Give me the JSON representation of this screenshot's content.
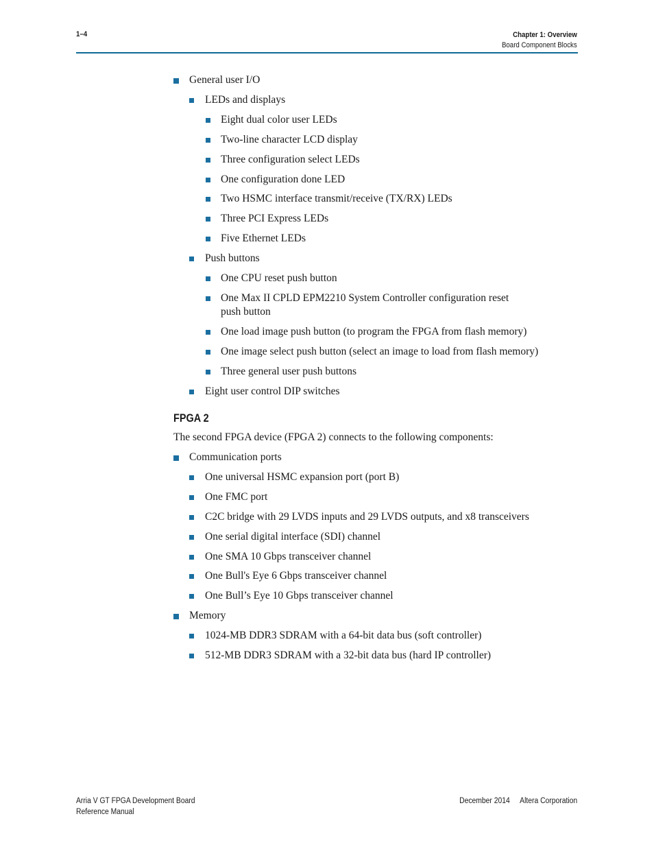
{
  "header": {
    "page_number": "1–4",
    "chapter": "Chapter 1:  Overview",
    "section": "Board Component Blocks"
  },
  "list_fpga1": [
    {
      "level": 1,
      "text": "General user I/O"
    },
    {
      "level": 2,
      "text": "LEDs and displays"
    },
    {
      "level": 3,
      "text": "Eight dual color user LEDs"
    },
    {
      "level": 3,
      "text": "Two-line character LCD display"
    },
    {
      "level": 3,
      "text": "Three configuration select LEDs"
    },
    {
      "level": 3,
      "text": "One configuration done LED"
    },
    {
      "level": 3,
      "text": "Two HSMC interface transmit/receive (TX/RX) LEDs"
    },
    {
      "level": 3,
      "text": "Three PCI Express LEDs"
    },
    {
      "level": 3,
      "text": "Five Ethernet LEDs"
    },
    {
      "level": 2,
      "text": "Push buttons"
    },
    {
      "level": 3,
      "text": "One CPU reset push button"
    },
    {
      "level": 3,
      "text": "One Max II CPLD EPM2210 System Controller configuration reset",
      "cont": "push button"
    },
    {
      "level": 3,
      "text": "One load image push button (to program the FPGA from flash memory)"
    },
    {
      "level": 3,
      "text": "One image select push button (select an image to load from flash memory)"
    },
    {
      "level": 3,
      "text": "Three general user push buttons"
    },
    {
      "level": 2,
      "text": "Eight user control DIP switches"
    }
  ],
  "fpga2": {
    "heading": "FPGA 2",
    "intro": "The second FPGA device (FPGA 2) connects to the following components:",
    "list": [
      {
        "level": 1,
        "text": "Communication ports"
      },
      {
        "level": 2,
        "text": "One universal HSMC expansion port (port B)"
      },
      {
        "level": 2,
        "text": "One FMC port"
      },
      {
        "level": 2,
        "text": "C2C bridge with 29 LVDS inputs and 29 LVDS outputs, and x8 transceivers"
      },
      {
        "level": 2,
        "text": "One serial digital interface (SDI) channel"
      },
      {
        "level": 2,
        "text": "One SMA 10 Gbps transceiver channel"
      },
      {
        "level": 2,
        "text": "One Bull's Eye 6 Gbps transceiver channel"
      },
      {
        "level": 2,
        "text": "One Bull’s Eye 10 Gbps transceiver channel"
      },
      {
        "level": 1,
        "text": "Memory"
      },
      {
        "level": 2,
        "text": "1024-MB DDR3 SDRAM with a 64-bit data bus (soft controller)"
      },
      {
        "level": 2,
        "text": "512-MB DDR3 SDRAM with a 32-bit data bus (hard IP controller)"
      }
    ]
  },
  "footer": {
    "title_line1": "Arria V GT FPGA Development Board",
    "title_line2": "Reference Manual",
    "date": "December 2014",
    "company": "Altera Corporation"
  },
  "colors": {
    "accent": "#0f6a96",
    "bullet": "#1b6fa0"
  }
}
